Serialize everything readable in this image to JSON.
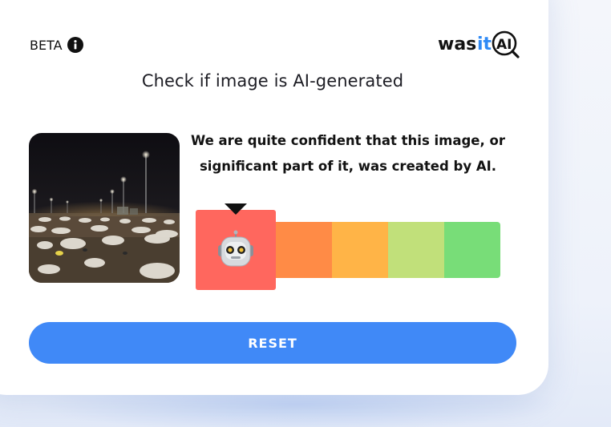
{
  "header": {
    "beta_label": "BETA",
    "info_icon": "info-icon",
    "logo": {
      "part1": "was",
      "part2": "it",
      "part3": "AI",
      "colors": {
        "dark": "#111111",
        "accent": "#2f8af5"
      }
    }
  },
  "title": "Check if image is AI-generated",
  "result": {
    "verdict_line1": "We are quite confident that this image, or",
    "verdict_line2": "significant part of it, was created by AI.",
    "scale": {
      "selected_index": 0,
      "selected_icon": "robot-icon",
      "segments": [
        {
          "color": "#ff675e"
        },
        {
          "color": "#ff8b46"
        },
        {
          "color": "#ffb447"
        },
        {
          "color": "#c1e07a"
        },
        {
          "color": "#78dd78"
        }
      ]
    }
  },
  "actions": {
    "reset_label": "RESET"
  },
  "colors": {
    "button": "#4089f7",
    "card": "#ffffff"
  }
}
